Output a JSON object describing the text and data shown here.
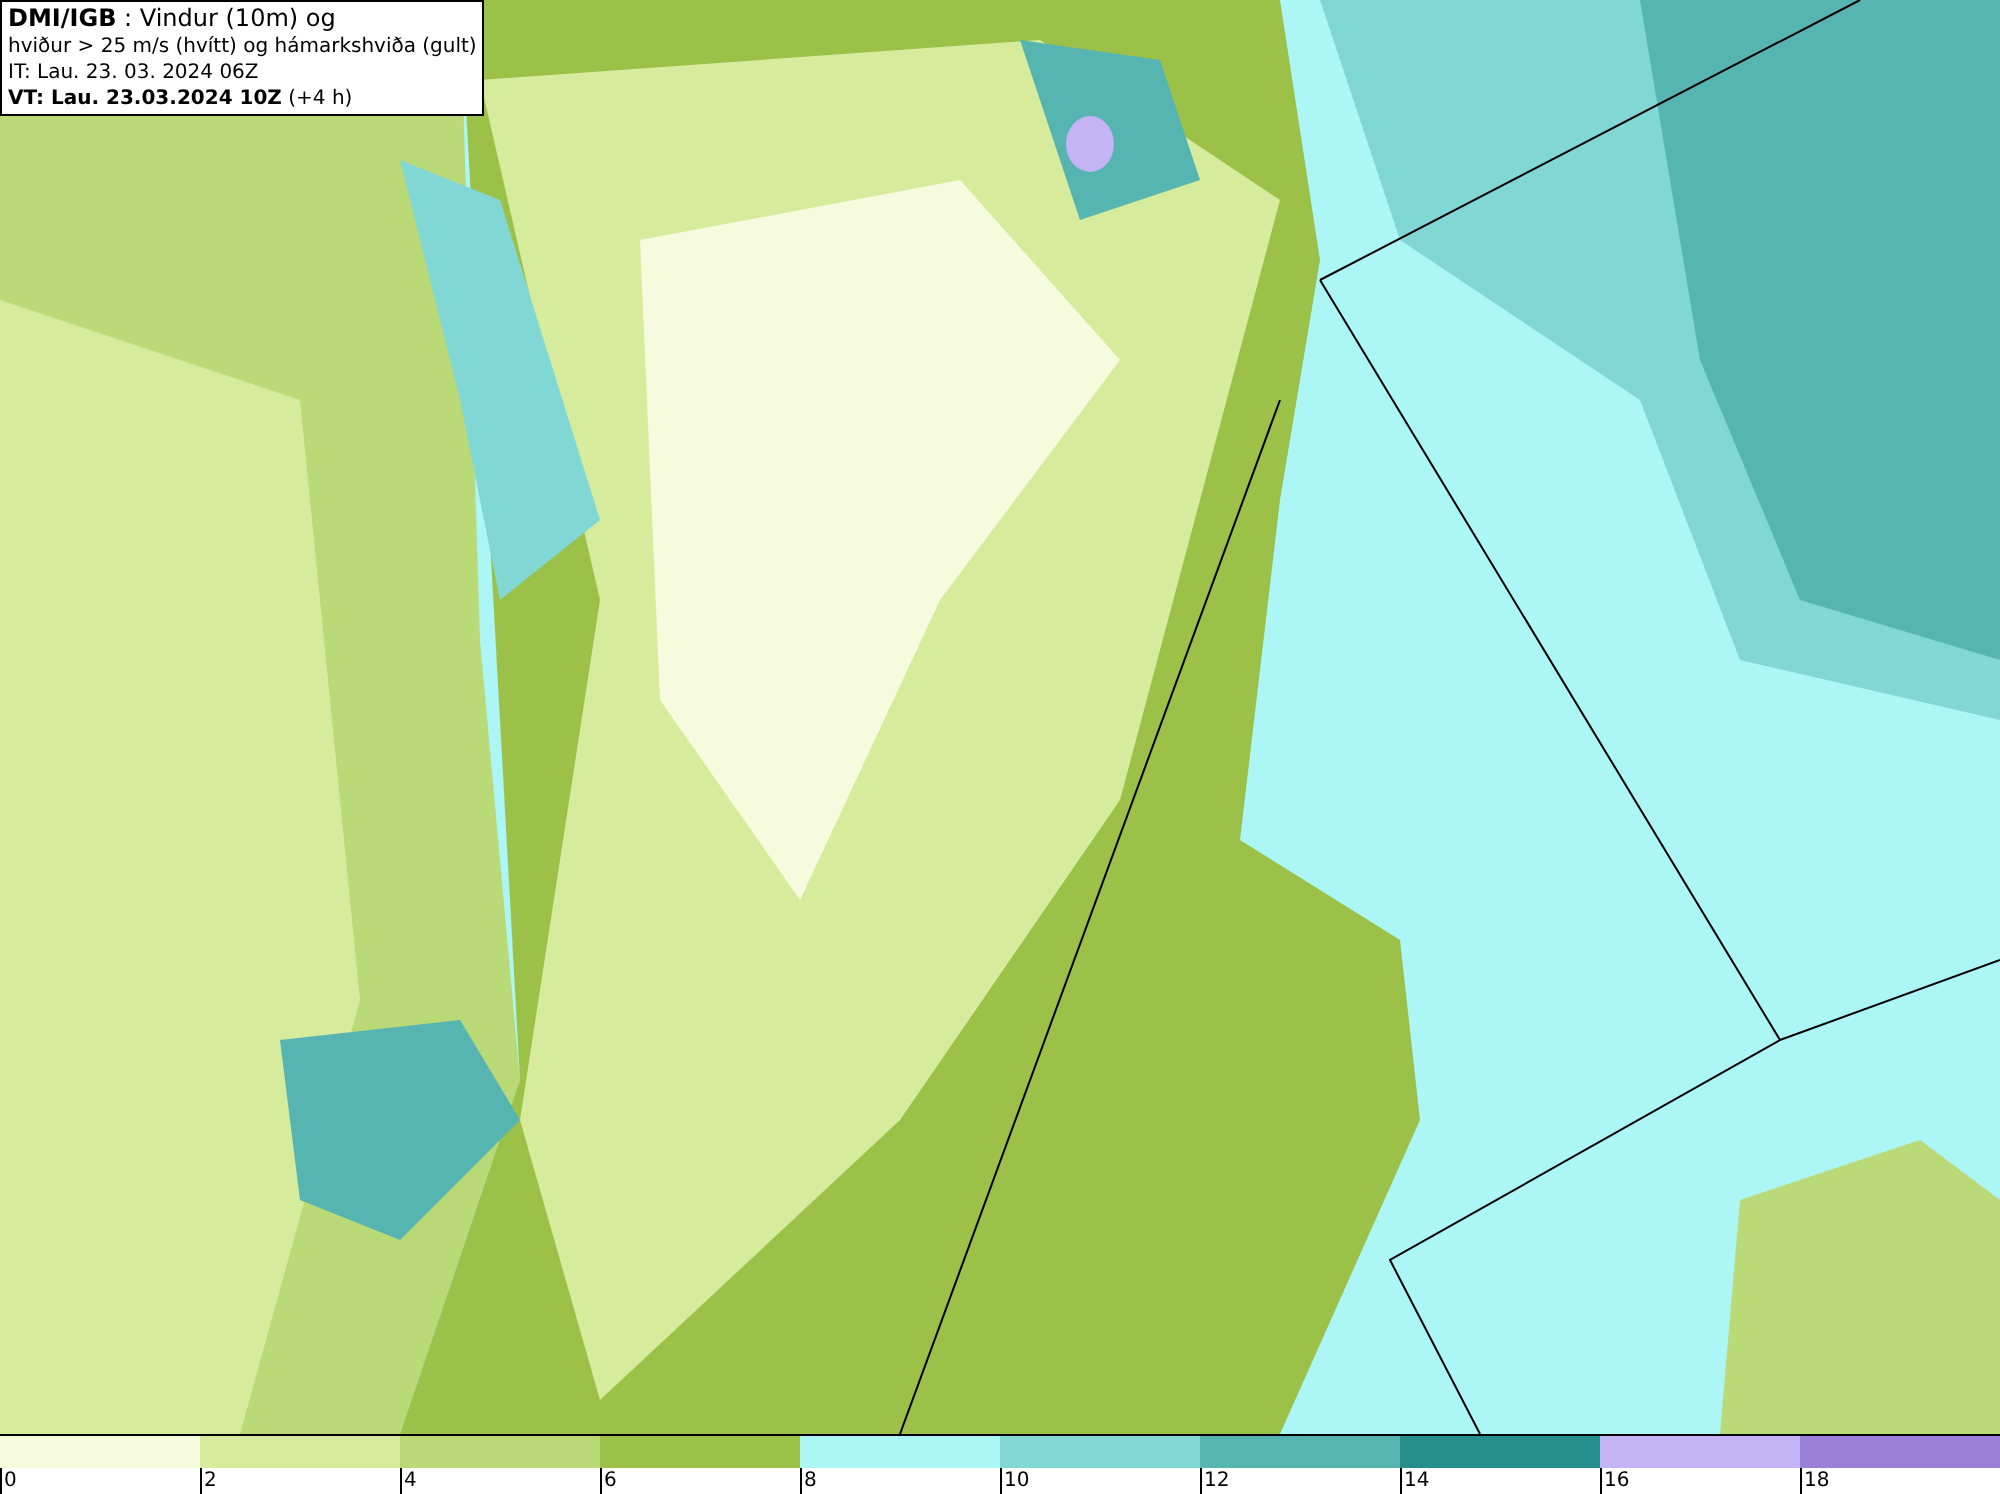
{
  "header": {
    "lines": [
      {
        "text": "**DMI/IGB** : Vindur (10m) og"
      },
      {
        "text": "hviður > 25 m/s (hvítt) og hámarkshviða (gult)"
      },
      {
        "text": "IT: Lau. 23. 03. 2024 06Z"
      },
      {
        "text": "**VT: Lau. 23.03.2024 10Z** (+4 h)"
      }
    ]
  },
  "legend": {
    "segments": [
      {
        "color": "#f5fbdc"
      },
      {
        "color": "#d6ec9c"
      },
      {
        "color": "#bada78"
      },
      {
        "color": "#9cc149"
      },
      {
        "color": "#acf6f6"
      },
      {
        "color": "#80d7d4"
      },
      {
        "color": "#56b4b1"
      },
      {
        "color": "#258f8b"
      },
      {
        "color": "#c4b4f6"
      },
      {
        "color": "#9a80d9"
      }
    ],
    "ticks": [
      "0",
      "2",
      "4",
      "6",
      "8",
      "10",
      "12",
      "14",
      "16",
      "18"
    ]
  }
}
